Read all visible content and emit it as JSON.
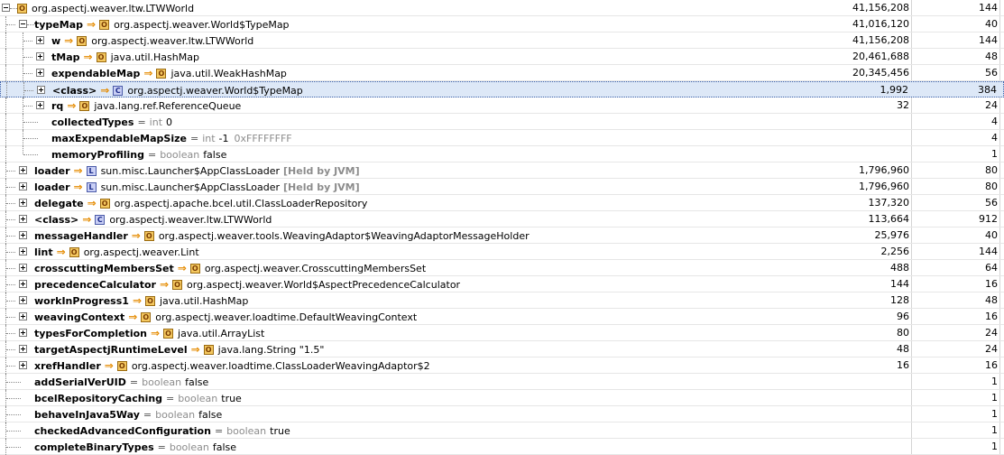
{
  "rows": [
    {
      "depth": 0,
      "exp": "minus",
      "name": "",
      "badge": "O",
      "cls": "org.aspectj.weaver.ltw.LTWWorld",
      "a": "41,156,208",
      "b": "144"
    },
    {
      "depth": 1,
      "exp": "minus",
      "name": "typeMap",
      "badge": "O",
      "cls": "org.aspectj.weaver.World$TypeMap",
      "a": "41,016,120",
      "b": "40"
    },
    {
      "depth": 2,
      "exp": "plus",
      "name": "w",
      "badge": "O",
      "cls": "org.aspectj.weaver.ltw.LTWWorld",
      "a": "41,156,208",
      "b": "144"
    },
    {
      "depth": 2,
      "exp": "plus",
      "name": "tMap",
      "badge": "O",
      "cls": "java.util.HashMap",
      "a": "20,461,688",
      "b": "48"
    },
    {
      "depth": 2,
      "exp": "plus",
      "name": "expendableMap",
      "badge": "O",
      "cls": "java.util.WeakHashMap",
      "a": "20,345,456",
      "b": "56"
    },
    {
      "depth": 2,
      "exp": "plus",
      "name": "<class>",
      "badge": "C",
      "cls": "org.aspectj.weaver.World$TypeMap",
      "a": "1,992",
      "b": "384",
      "sel": true
    },
    {
      "depth": 2,
      "exp": "plus",
      "name": "rq",
      "badge": "O",
      "cls": "java.lang.ref.ReferenceQueue",
      "a": "32",
      "b": "24"
    },
    {
      "depth": 2,
      "exp": "",
      "name": "collectedTypes",
      "ptype": "int",
      "pval": "0",
      "a": "",
      "b": "4"
    },
    {
      "depth": 2,
      "exp": "",
      "name": "maxExpendableMapSize",
      "ptype": "int",
      "pval": "-1",
      "hex": "0xFFFFFFFF",
      "a": "",
      "b": "4"
    },
    {
      "depth": 2,
      "exp": "",
      "name": "memoryProfiling",
      "ptype": "boolean",
      "pval": "false",
      "a": "",
      "b": "1",
      "last": true
    },
    {
      "depth": 1,
      "exp": "plus",
      "name": "loader",
      "badge": "L",
      "cls": "sun.misc.Launcher$AppClassLoader",
      "held": "[Held by JVM]",
      "a": "1,796,960",
      "b": "80"
    },
    {
      "depth": 1,
      "exp": "plus",
      "name": "loader",
      "badge": "L",
      "cls": "sun.misc.Launcher$AppClassLoader",
      "held": "[Held by JVM]",
      "a": "1,796,960",
      "b": "80"
    },
    {
      "depth": 1,
      "exp": "plus",
      "name": "delegate",
      "badge": "O",
      "cls": "org.aspectj.apache.bcel.util.ClassLoaderRepository",
      "a": "137,320",
      "b": "56"
    },
    {
      "depth": 1,
      "exp": "plus",
      "name": "<class>",
      "badge": "C",
      "cls": "org.aspectj.weaver.ltw.LTWWorld",
      "a": "113,664",
      "b": "912"
    },
    {
      "depth": 1,
      "exp": "plus",
      "name": "messageHandler",
      "badge": "O",
      "cls": "org.aspectj.weaver.tools.WeavingAdaptor$WeavingAdaptorMessageHolder",
      "a": "25,976",
      "b": "40"
    },
    {
      "depth": 1,
      "exp": "plus",
      "name": "lint",
      "badge": "O",
      "cls": "org.aspectj.weaver.Lint",
      "a": "2,256",
      "b": "144"
    },
    {
      "depth": 1,
      "exp": "plus",
      "name": "crosscuttingMembersSet",
      "badge": "O",
      "cls": "org.aspectj.weaver.CrosscuttingMembersSet",
      "a": "488",
      "b": "64"
    },
    {
      "depth": 1,
      "exp": "plus",
      "name": "precedenceCalculator",
      "badge": "O",
      "cls": "org.aspectj.weaver.World$AspectPrecedenceCalculator",
      "a": "144",
      "b": "16"
    },
    {
      "depth": 1,
      "exp": "plus",
      "name": "workInProgress1",
      "badge": "O",
      "cls": "java.util.HashMap",
      "a": "128",
      "b": "48"
    },
    {
      "depth": 1,
      "exp": "plus",
      "name": "weavingContext",
      "badge": "O",
      "cls": "org.aspectj.weaver.loadtime.DefaultWeavingContext",
      "a": "96",
      "b": "16"
    },
    {
      "depth": 1,
      "exp": "plus",
      "name": "typesForCompletion",
      "badge": "O",
      "cls": "java.util.ArrayList",
      "a": "80",
      "b": "24"
    },
    {
      "depth": 1,
      "exp": "plus",
      "name": "targetAspectjRuntimeLevel",
      "badge": "O",
      "cls": "java.lang.String \"1.5\"",
      "a": "48",
      "b": "24"
    },
    {
      "depth": 1,
      "exp": "plus",
      "name": "xrefHandler",
      "badge": "O",
      "cls": "org.aspectj.weaver.loadtime.ClassLoaderWeavingAdaptor$2",
      "a": "16",
      "b": "16"
    },
    {
      "depth": 1,
      "exp": "",
      "name": "addSerialVerUID",
      "ptype": "boolean",
      "pval": "false",
      "a": "",
      "b": "1"
    },
    {
      "depth": 1,
      "exp": "",
      "name": "bcelRepositoryCaching",
      "ptype": "boolean",
      "pval": "true",
      "a": "",
      "b": "1"
    },
    {
      "depth": 1,
      "exp": "",
      "name": "behaveInJava5Way",
      "ptype": "boolean",
      "pval": "false",
      "a": "",
      "b": "1"
    },
    {
      "depth": 1,
      "exp": "",
      "name": "checkedAdvancedConfiguration",
      "ptype": "boolean",
      "pval": "true",
      "a": "",
      "b": "1"
    },
    {
      "depth": 1,
      "exp": "",
      "name": "completeBinaryTypes",
      "ptype": "boolean",
      "pval": "false",
      "a": "",
      "b": "1"
    }
  ]
}
